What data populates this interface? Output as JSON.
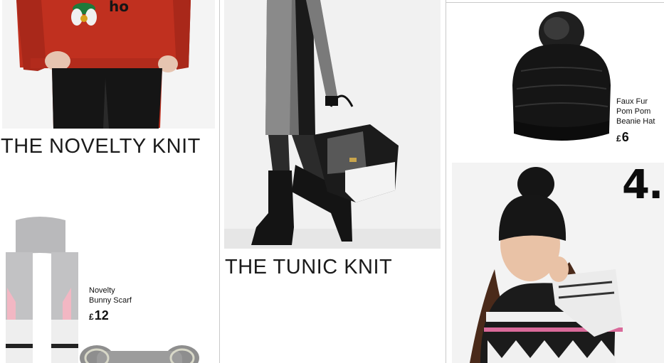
{
  "sections": {
    "novelty": {
      "heading": "THE NOVELTY KNIT"
    },
    "tunic": {
      "heading": "THE TUNIC KNIT"
    },
    "beanie_section": {
      "number": "4."
    }
  },
  "products": {
    "scarf": {
      "name_line1": "Novelty",
      "name_line2": "Bunny Scarf",
      "currency": "£",
      "price": "12"
    },
    "hat": {
      "name_line1": "Faux Fur",
      "name_line2": "Pom Pom",
      "name_line3": "Beanie Hat",
      "currency": "£",
      "price": "6"
    }
  },
  "colors": {
    "jumper_red": "#c0301f",
    "text": "#111111",
    "divider": "#c9c9c9"
  }
}
